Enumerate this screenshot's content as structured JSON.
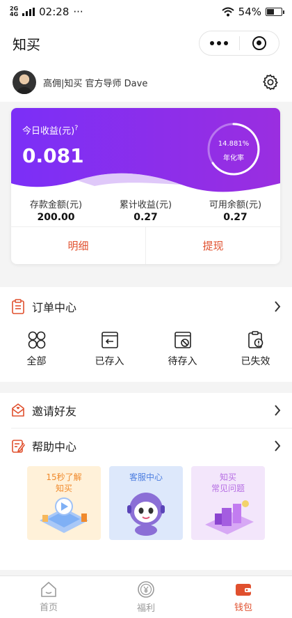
{
  "status_bar": {
    "network_top": "2G",
    "network_bottom": "4G",
    "time": "02:28",
    "dots": "···",
    "battery": "54%",
    "battery_level": 0.54
  },
  "nav": {
    "title": "知买"
  },
  "user": {
    "name": "高佣|知买 官方导师 Dave"
  },
  "earnings": {
    "today_label": "今日收益(元)",
    "help_mark": "?",
    "today_value": "0.081",
    "annual_rate": "14.881%",
    "annual_label": "年化率",
    "stats": [
      {
        "label": "存款金额(元)",
        "value": "200.00"
      },
      {
        "label": "累计收益(元)",
        "value": "0.27"
      },
      {
        "label": "可用余额(元)",
        "value": "0.27"
      }
    ],
    "detail_button": "明细",
    "withdraw_button": "提现"
  },
  "orders": {
    "title": "订单中心",
    "items": [
      {
        "label": "全部",
        "icon": "grid-icon"
      },
      {
        "label": "已存入",
        "icon": "deposited-icon"
      },
      {
        "label": "待存入",
        "icon": "pending-icon"
      },
      {
        "label": "已失效",
        "icon": "expired-icon"
      }
    ]
  },
  "invite": {
    "title": "邀请好友"
  },
  "help": {
    "title": "帮助中心",
    "cards": [
      {
        "line1": "15秒了解",
        "line2": "知买"
      },
      {
        "line1": "客服中心",
        "line2": ""
      },
      {
        "line1": "知买",
        "line2": "常见问题"
      }
    ]
  },
  "tabbar": {
    "items": [
      {
        "label": "首页",
        "icon": "home-icon"
      },
      {
        "label": "福利",
        "icon": "yen-coin-icon"
      },
      {
        "label": "钱包",
        "icon": "wallet-icon"
      }
    ],
    "active_index": 2
  },
  "colors": {
    "purple": "#8a2be2",
    "accent": "#e0502e"
  }
}
